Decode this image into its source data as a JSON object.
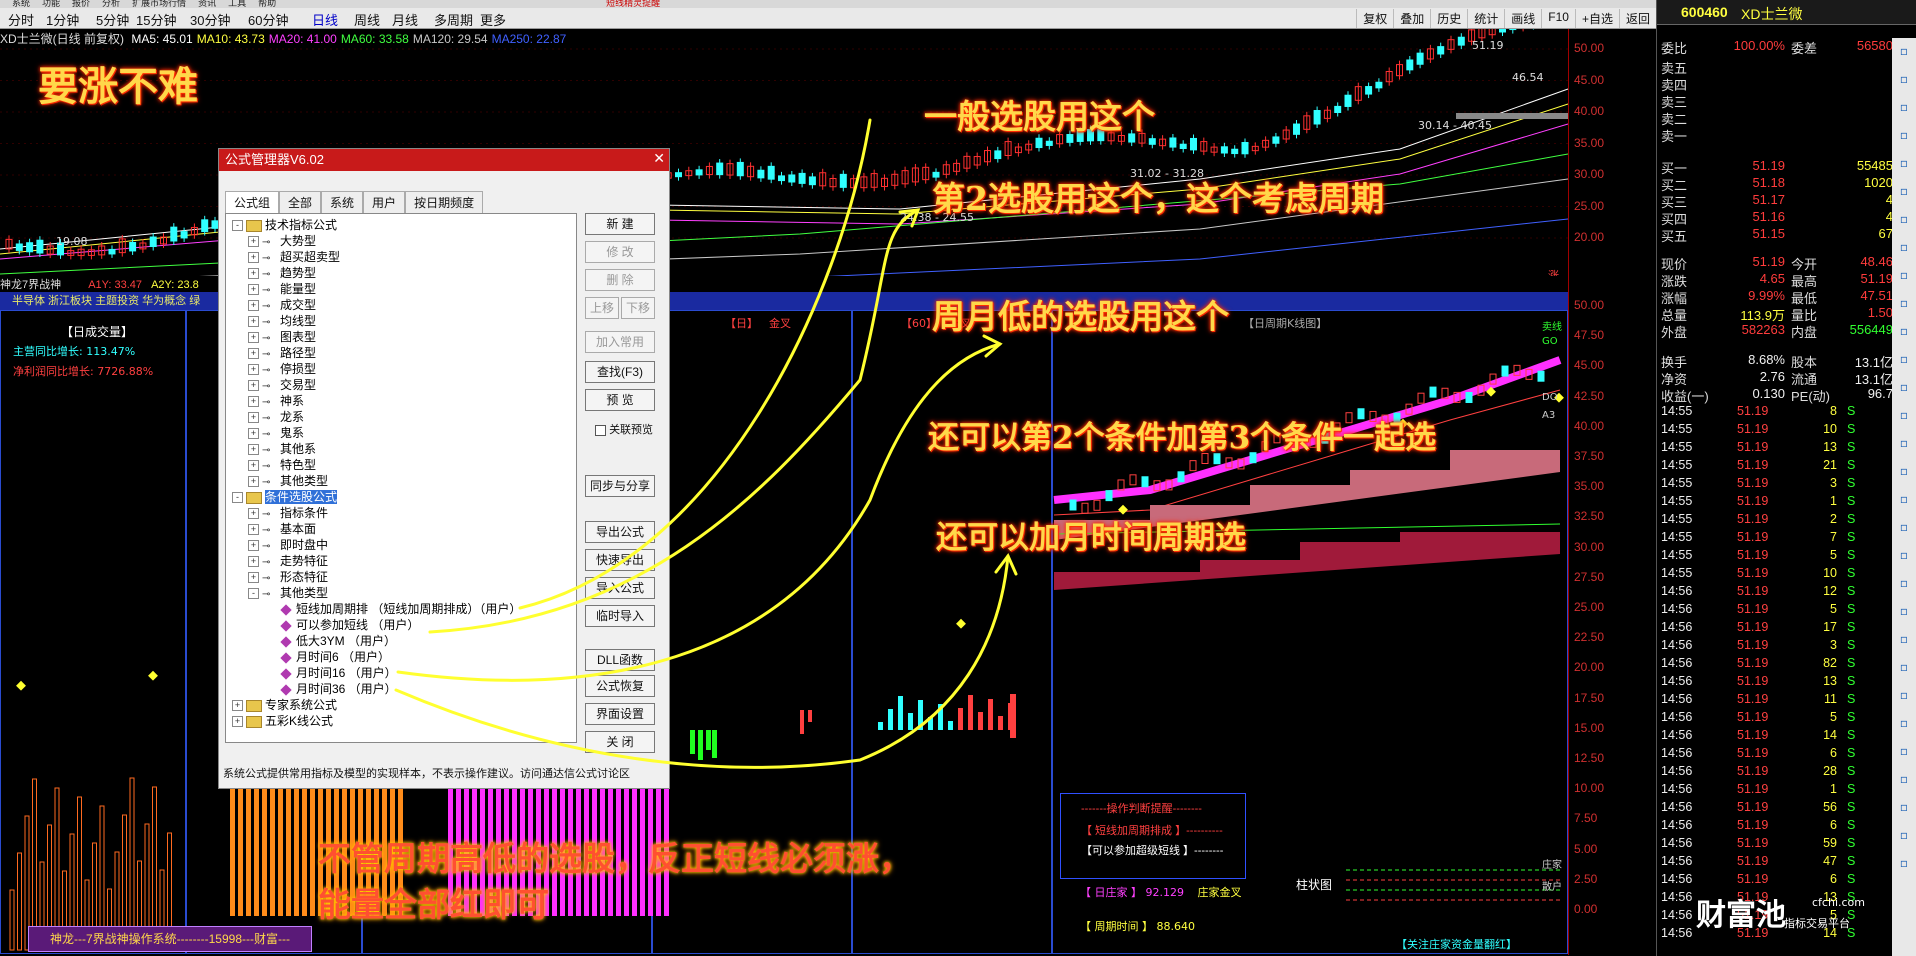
{
  "topmenu": {
    "items": [
      "系统",
      "功能",
      "报价",
      "分析",
      "扩展市场行情",
      "资讯",
      "工具",
      "帮助"
    ],
    "title": "短线精灵提醒"
  },
  "toolbar": {
    "periods": [
      "分时",
      "1分钟",
      "5分钟",
      "15分钟",
      "30分钟",
      "60分钟",
      "日线",
      "周线",
      "月线",
      "多周期",
      "更多"
    ],
    "active": "日线",
    "right_tools": [
      "复权",
      "叠加",
      "历史",
      "统计",
      "画线",
      "F10",
      "+自选",
      "返回"
    ]
  },
  "chart": {
    "stock_label": "XD士兰微(日线 前复权)",
    "ma": [
      {
        "name": "MA5:",
        "value": "45.01",
        "color": "#ffffff"
      },
      {
        "name": "MA10:",
        "value": "43.73",
        "color": "#ffff40"
      },
      {
        "name": "MA20:",
        "value": "41.00",
        "color": "#ff40ff"
      },
      {
        "name": "MA60:",
        "value": "33.58",
        "color": "#40ff40"
      },
      {
        "name": "MA120:",
        "value": "29.54",
        "color": "#c8c8c8"
      },
      {
        "name": "MA250:",
        "value": "22.87",
        "color": "#4060ff"
      }
    ],
    "price_axis": [
      "50.00",
      "45.00",
      "40.00",
      "35.00",
      "30.00",
      "25.00",
      "20.00"
    ],
    "annotations": [
      "51.19",
      "46.54",
      "30.14 - 40.45",
      "31.02 - 31.28",
      "24.38 - 24.55",
      "19.08"
    ],
    "labels": [
      "财",
      "股",
      "涨"
    ]
  },
  "subheader": {
    "title": "神龙7界战神",
    "a1": "A1Y: 33.47",
    "a2": "A2Y: 23.8"
  },
  "bluebar": {
    "text": "半导体 浙江板块 主题投资 华为概念 绿"
  },
  "left_panel": {
    "title": "【日成交量】",
    "growth1": "主营同比增长: 113.47%",
    "growth2": "净利润同比增长: 7726.88%"
  },
  "mid_panels": {
    "day_label": "【日】",
    "day_cross": "金叉",
    "p60_label": "【60】",
    "p60_cross": "金叉",
    "week_title": "【日周期K线图】"
  },
  "right_axis2": [
    "50.00",
    "47.50",
    "45.00",
    "42.50",
    "40.00",
    "37.50",
    "35.00",
    "32.50",
    "30.00",
    "27.50",
    "25.00",
    "22.50",
    "20.00",
    "17.50",
    "15.00",
    "12.50",
    "10.00",
    "7.50",
    "5.00",
    "2.50",
    "0.00"
  ],
  "side_tags": [
    "卖线",
    "GO",
    "DO",
    "A3",
    "庄家",
    "散户"
  ],
  "quote": {
    "code": "600460",
    "name": "XD士兰微",
    "wb": {
      "label": "委比",
      "value": "100.00%",
      "label2": "委差",
      "value2": "56580"
    },
    "sells": [
      {
        "label": "卖五",
        "price": "",
        "vol": ""
      },
      {
        "label": "卖四",
        "price": "",
        "vol": ""
      },
      {
        "label": "卖三",
        "price": "",
        "vol": ""
      },
      {
        "label": "卖二",
        "price": "",
        "vol": ""
      },
      {
        "label": "卖一",
        "price": "",
        "vol": ""
      }
    ],
    "buys": [
      {
        "label": "买一",
        "price": "51.19",
        "vol": "55485"
      },
      {
        "label": "买二",
        "price": "51.18",
        "vol": "1020"
      },
      {
        "label": "买三",
        "price": "51.17",
        "vol": "4"
      },
      {
        "label": "买四",
        "price": "51.16",
        "vol": "4"
      },
      {
        "label": "买五",
        "price": "51.15",
        "vol": "67"
      }
    ],
    "stats": [
      {
        "l": "现价",
        "v": "51.19",
        "l2": "今开",
        "v2": "48.46"
      },
      {
        "l": "涨跌",
        "v": "4.65",
        "l2": "最高",
        "v2": "51.19"
      },
      {
        "l": "涨幅",
        "v": "9.99%",
        "l2": "最低",
        "v2": "47.51"
      },
      {
        "l": "总量",
        "v": "113.9万",
        "l2": "量比",
        "v2": "1.50"
      },
      {
        "l": "外盘",
        "v": "582263",
        "l2": "内盘",
        "v2": "556449"
      }
    ],
    "stats2": [
      {
        "l": "换手",
        "v": "8.68%",
        "l2": "股本",
        "v2": "13.1亿"
      },
      {
        "l": "净资",
        "v": "2.76",
        "l2": "流通",
        "v2": "13.1亿"
      },
      {
        "l": "收益(一)",
        "v": "0.130",
        "l2": "PE(动)",
        "v2": "96.7"
      }
    ],
    "ticks": [
      {
        "t": "14:55",
        "p": "51.19",
        "v": "8",
        "f": "S"
      },
      {
        "t": "14:55",
        "p": "51.19",
        "v": "10",
        "f": "S"
      },
      {
        "t": "14:55",
        "p": "51.19",
        "v": "13",
        "f": "S"
      },
      {
        "t": "14:55",
        "p": "51.19",
        "v": "21",
        "f": "S"
      },
      {
        "t": "14:55",
        "p": "51.19",
        "v": "3",
        "f": "S"
      },
      {
        "t": "14:55",
        "p": "51.19",
        "v": "1",
        "f": "S"
      },
      {
        "t": "14:55",
        "p": "51.19",
        "v": "2",
        "f": "S"
      },
      {
        "t": "14:55",
        "p": "51.19",
        "v": "7",
        "f": "S"
      },
      {
        "t": "14:55",
        "p": "51.19",
        "v": "5",
        "f": "S"
      },
      {
        "t": "14:55",
        "p": "51.19",
        "v": "10",
        "f": "S"
      },
      {
        "t": "14:56",
        "p": "51.19",
        "v": "12",
        "f": "S"
      },
      {
        "t": "14:56",
        "p": "51.19",
        "v": "5",
        "f": "S"
      },
      {
        "t": "14:56",
        "p": "51.19",
        "v": "17",
        "f": "S"
      },
      {
        "t": "14:56",
        "p": "51.19",
        "v": "3",
        "f": "S"
      },
      {
        "t": "14:56",
        "p": "51.19",
        "v": "82",
        "f": "S"
      },
      {
        "t": "14:56",
        "p": "51.19",
        "v": "13",
        "f": "S"
      },
      {
        "t": "14:56",
        "p": "51.19",
        "v": "11",
        "f": "S"
      },
      {
        "t": "14:56",
        "p": "51.19",
        "v": "5",
        "f": "S"
      },
      {
        "t": "14:56",
        "p": "51.19",
        "v": "14",
        "f": "S"
      },
      {
        "t": "14:56",
        "p": "51.19",
        "v": "6",
        "f": "S"
      },
      {
        "t": "14:56",
        "p": "51.19",
        "v": "28",
        "f": "S"
      },
      {
        "t": "14:56",
        "p": "51.19",
        "v": "1",
        "f": "S"
      },
      {
        "t": "14:56",
        "p": "51.19",
        "v": "56",
        "f": "S"
      },
      {
        "t": "14:56",
        "p": "51.19",
        "v": "6",
        "f": "S"
      },
      {
        "t": "14:56",
        "p": "51.19",
        "v": "59",
        "f": "S"
      },
      {
        "t": "14:56",
        "p": "51.19",
        "v": "47",
        "f": "S"
      },
      {
        "t": "14:56",
        "p": "51.19",
        "v": "6",
        "f": "S"
      },
      {
        "t": "14:56",
        "p": "51.19",
        "v": "13",
        "f": "S"
      },
      {
        "t": "14:56",
        "p": "51.19",
        "v": "5",
        "f": "S"
      },
      {
        "t": "14:56",
        "p": "51.19",
        "v": "14",
        "f": "S"
      }
    ]
  },
  "dialog": {
    "title": "公式管理器V6.02",
    "tabs": [
      "公式组",
      "全部",
      "系统",
      "用户",
      "按日期频度"
    ],
    "tree": [
      {
        "depth": 0,
        "exp": "-",
        "type": "folder",
        "label": "技术指标公式"
      },
      {
        "depth": 1,
        "exp": "+",
        "type": "key",
        "label": "大势型"
      },
      {
        "depth": 1,
        "exp": "+",
        "type": "key",
        "label": "超买超卖型"
      },
      {
        "depth": 1,
        "exp": "+",
        "type": "key",
        "label": "趋势型"
      },
      {
        "depth": 1,
        "exp": "+",
        "type": "key",
        "label": "能量型"
      },
      {
        "depth": 1,
        "exp": "+",
        "type": "key",
        "label": "成交型"
      },
      {
        "depth": 1,
        "exp": "+",
        "type": "key",
        "label": "均线型"
      },
      {
        "depth": 1,
        "exp": "+",
        "type": "key",
        "label": "图表型"
      },
      {
        "depth": 1,
        "exp": "+",
        "type": "key",
        "label": "路径型"
      },
      {
        "depth": 1,
        "exp": "+",
        "type": "key",
        "label": "停损型"
      },
      {
        "depth": 1,
        "exp": "+",
        "type": "key",
        "label": "交易型"
      },
      {
        "depth": 1,
        "exp": "+",
        "type": "key",
        "label": "神系"
      },
      {
        "depth": 1,
        "exp": "+",
        "type": "key",
        "label": "龙系"
      },
      {
        "depth": 1,
        "exp": "+",
        "type": "key",
        "label": "鬼系"
      },
      {
        "depth": 1,
        "exp": "+",
        "type": "key",
        "label": "其他系"
      },
      {
        "depth": 1,
        "exp": "+",
        "type": "key",
        "label": "特色型"
      },
      {
        "depth": 1,
        "exp": "+",
        "type": "key",
        "label": "其他类型"
      },
      {
        "depth": 0,
        "exp": "-",
        "type": "folder",
        "label": "条件选股公式",
        "hl": true
      },
      {
        "depth": 1,
        "exp": "+",
        "type": "key",
        "label": "指标条件"
      },
      {
        "depth": 1,
        "exp": "+",
        "type": "key",
        "label": "基本面"
      },
      {
        "depth": 1,
        "exp": "+",
        "type": "key",
        "label": "即时盘中"
      },
      {
        "depth": 1,
        "exp": "+",
        "type": "key",
        "label": "走势特征"
      },
      {
        "depth": 1,
        "exp": "+",
        "type": "key",
        "label": "形态特征"
      },
      {
        "depth": 1,
        "exp": "-",
        "type": "key",
        "label": "其他类型"
      },
      {
        "depth": 2,
        "exp": "",
        "type": "dia",
        "label": "短线加周期排  （短线加周期排成）（用户）"
      },
      {
        "depth": 2,
        "exp": "",
        "type": "dia",
        "label": "可以参加短线   （用户）"
      },
      {
        "depth": 2,
        "exp": "",
        "type": "dia",
        "label": "低大3YM   （用户）"
      },
      {
        "depth": 2,
        "exp": "",
        "type": "dia",
        "label": "月时间6   （用户）"
      },
      {
        "depth": 2,
        "exp": "",
        "type": "dia",
        "label": "月时间16   （用户）"
      },
      {
        "depth": 2,
        "exp": "",
        "type": "dia",
        "label": "月时间36   （用户）"
      },
      {
        "depth": 0,
        "exp": "+",
        "type": "folder",
        "label": "专家系统公式"
      },
      {
        "depth": 0,
        "exp": "+",
        "type": "folder",
        "label": "五彩K线公式"
      }
    ],
    "buttons": [
      {
        "label": "新  建",
        "disabled": false
      },
      {
        "label": "修  改",
        "disabled": true
      },
      {
        "label": "删  除",
        "disabled": true
      },
      {
        "label": "上移",
        "disabled": true
      },
      {
        "label": "下移",
        "disabled": true
      },
      {
        "label": "加入常用",
        "disabled": true
      },
      {
        "label": "查找(F3)",
        "disabled": false
      },
      {
        "label": "预  览",
        "disabled": false
      },
      {
        "label": "同步与分享",
        "disabled": false
      },
      {
        "label": "导出公式",
        "disabled": false
      },
      {
        "label": "快速导出",
        "disabled": false
      },
      {
        "label": "导入公式",
        "disabled": false
      },
      {
        "label": "临时导入",
        "disabled": false
      },
      {
        "label": "DLL函数",
        "disabled": false
      },
      {
        "label": "公式恢复",
        "disabled": false
      },
      {
        "label": "界面设置",
        "disabled": false
      },
      {
        "label": "关  闭",
        "disabled": false
      }
    ],
    "checkbox": "关联预览",
    "status": "系统公式提供常用指标及模型的实现样本，不表示操作建议。访问通达信公式讨论区"
  },
  "annotations": {
    "a1": "要涨不难",
    "a2": "一般选股用这个",
    "a3": "第2选股用这个，这个考虑周期",
    "a4": "周月低的选股用这个",
    "a5": "还可以第2个条件加第3个条件一起选",
    "a6": "还可以加月时间周期选",
    "a7": "不管周期高低的选股，反正短线必须涨，",
    "a8": "能量全部红即可"
  },
  "opbox": {
    "title": "-------操作判断提醒--------",
    "l1": "【 短线加周期排成 】----------",
    "l2": "【可以参加超级短线 】--------",
    "l3a": "【 日庄家 】 92.129",
    "l3b": "庄家金叉",
    "l4a": "【 周期时间 】 88.640"
  },
  "bottom_labels": {
    "bar_label": "柱状图",
    "scroll_label": "【关注庄家资金量翻红】"
  },
  "footer": {
    "text": "神龙---7界战神操作系统--------15998---财富---"
  },
  "logo": {
    "main": "财富池",
    "domain": "cfchi.com",
    "sub": "指标交易平台"
  }
}
